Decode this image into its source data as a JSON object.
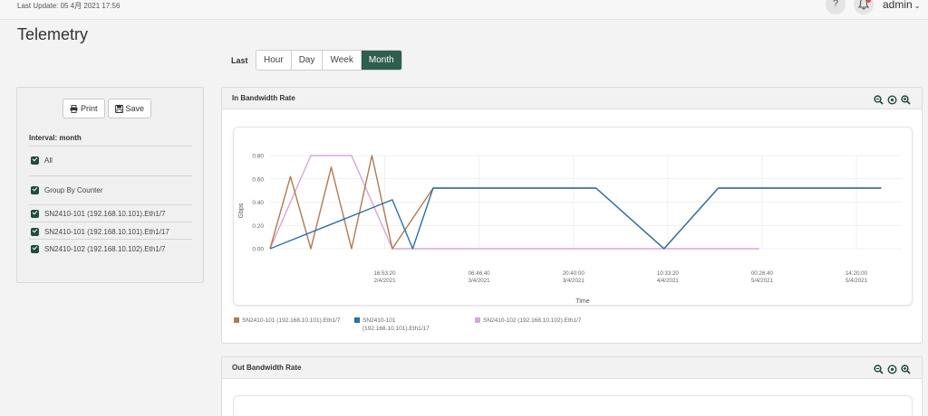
{
  "header": {
    "last_update": "Last Update: 05 4月 2021 17:56",
    "help": "?",
    "user": "admin"
  },
  "page": {
    "title": "Telemetry"
  },
  "range": {
    "label": "Last",
    "options": [
      "Hour",
      "Day",
      "Week",
      "Month"
    ],
    "selected": "Month"
  },
  "sidebar": {
    "print_label": "Print",
    "save_label": "Save",
    "interval": "Interval: month",
    "all_label": "All",
    "group_label": "Group By Counter",
    "items": [
      "SN2410-101 (192.168.10.101).Eth1/7",
      "SN2410-101 (192.168.10.101).Eth1/17",
      "SN2410-102 (192.168.10.102).Eth1/7"
    ]
  },
  "cards": {
    "in_title": "In Bandwidth Rate",
    "out_title": "Out Bandwidth Rate"
  },
  "chart_data": {
    "type": "line",
    "title": "In Bandwidth Rate",
    "ylabel": "Gbps",
    "xlabel": "Time",
    "ylim": [
      0,
      0.8
    ],
    "yticks": [
      "0.80",
      "0.60",
      "0.40",
      "0.20",
      "0.00"
    ],
    "xticks": [
      {
        "time": "16:53:20",
        "date": "2/4/2021"
      },
      {
        "time": "06:46:40",
        "date": "3/4/2021"
      },
      {
        "time": "20:40:00",
        "date": "3/4/2021"
      },
      {
        "time": "10:33:20",
        "date": "4/4/2021"
      },
      {
        "time": "00:26:40",
        "date": "5/4/2021"
      },
      {
        "time": "14:20:00",
        "date": "5/4/2021"
      }
    ],
    "series": [
      {
        "name": "SN2410-101 (192.168.10.101).Eth1/7",
        "color": "#b07a52",
        "x": [
          "2/4/2021 00:00",
          "2/4/2021 03:00",
          "2/4/2021 06:00",
          "2/4/2021 09:00",
          "2/4/2021 12:00",
          "2/4/2021 15:00",
          "2/4/2021 18:00",
          "3/4/2021 00:00",
          "3/4/2021 12:00",
          "4/4/2021 00:00",
          "4/4/2021 10:00",
          "4/4/2021 18:00",
          "5/4/2021 00:00",
          "5/4/2021 18:00"
        ],
        "values": [
          0.0,
          0.62,
          0.0,
          0.7,
          0.0,
          0.8,
          0.0,
          0.52,
          0.52,
          0.52,
          0.0,
          0.52,
          0.52,
          0.52
        ]
      },
      {
        "name": "SN2410-101 (192.168.10.101).Eth1/17",
        "color": "#2f6fa8",
        "x": [
          "2/4/2021 00:00",
          "2/4/2021 18:00",
          "2/4/2021 21:00",
          "3/4/2021 00:00",
          "3/4/2021 12:00",
          "4/4/2021 00:00",
          "4/4/2021 10:00",
          "4/4/2021 18:00",
          "5/4/2021 00:00",
          "5/4/2021 18:00"
        ],
        "values": [
          0.0,
          0.42,
          0.0,
          0.52,
          0.52,
          0.52,
          0.0,
          0.52,
          0.52,
          0.52
        ]
      },
      {
        "name": "SN2410-102 (192.168.10.102).Eth1/7",
        "color": "#d8a6d8",
        "x": [
          "2/4/2021 00:00",
          "2/4/2021 06:00",
          "2/4/2021 12:00",
          "2/4/2021 18:00",
          "3/4/2021 12:00",
          "4/4/2021 12:00",
          "5/4/2021 00:00"
        ],
        "values": [
          0.0,
          0.8,
          0.8,
          0.0,
          0.0,
          0.0,
          0.0
        ]
      }
    ],
    "grid": true,
    "legend": "bottom"
  }
}
